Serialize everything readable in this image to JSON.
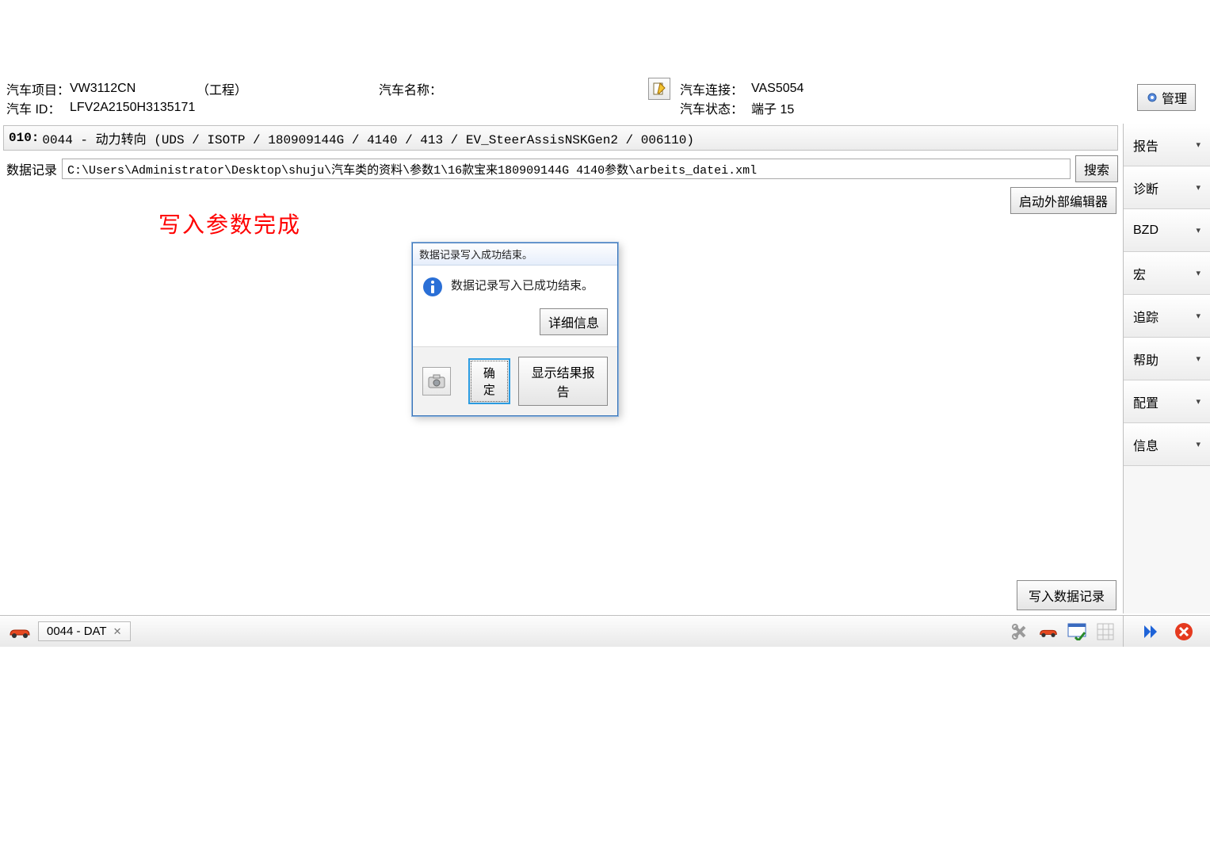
{
  "header": {
    "project_label": "汽车项目：",
    "project_value": "VW3112CN",
    "mode": "（工程）",
    "name_label": "汽车名称：",
    "name_value": "",
    "id_label": "汽车 ID：",
    "id_value": "LFV2A2150H3135171",
    "conn_label": "汽车连接：",
    "conn_value": "VAS5054",
    "status_label": "汽车状态：",
    "status_value": "端子 15",
    "manage_btn": "管理"
  },
  "ecu_line": {
    "prefix": "010:",
    "text": " 0044 - 动力转向  (UDS / ISOTP / 180909144G / 4140 / 413 / EV_SteerAssisNSKGen2 / 006110)"
  },
  "data_record": {
    "label": "数据记录",
    "path": "C:\\Users\\Administrator\\Desktop\\shuju\\汽车类的资料\\参数1\\16款宝来180909144G 4140参数\\arbeits_datei.xml",
    "search_btn": "搜索",
    "editor_btn": "启动外部编辑器"
  },
  "message": "写入参数完成",
  "dialog": {
    "title": "数据记录写入成功结束。",
    "body": "数据记录写入已成功结束。",
    "details_btn": "详细信息",
    "ok_btn": "确定",
    "report_btn": "显示结果报告"
  },
  "write_btn": "写入数据记录",
  "sidebar": [
    "报告",
    "诊断",
    "BZD",
    "宏",
    "追踪",
    "帮助",
    "配置",
    "信息"
  ],
  "bottom": {
    "tab": "0044 - DAT"
  }
}
